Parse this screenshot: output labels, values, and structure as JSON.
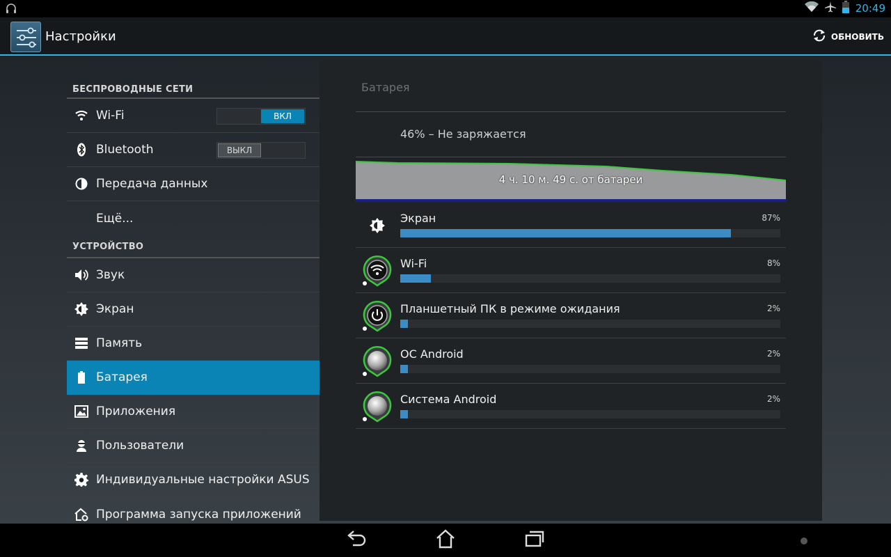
{
  "status_bar": {
    "time": "20:49",
    "icons": [
      "headset-icon",
      "wifi-icon",
      "airplane-icon",
      "battery-icon"
    ]
  },
  "action_bar": {
    "title": "Настройки",
    "refresh_label": "ОБНОВИТЬ",
    "app_icon": "settings-sliders-icon",
    "refresh_icon": "refresh-icon"
  },
  "sidebar": {
    "sections": [
      {
        "header": "БЕСПРОВОДНЫЕ СЕТИ",
        "items": [
          {
            "label": "Wi-Fi",
            "icon": "wifi-icon",
            "toggle": "ВКЛ",
            "toggle_on": true
          },
          {
            "label": "Bluetooth",
            "icon": "bluetooth-icon",
            "toggle": "ВЫКЛ",
            "toggle_on": false
          },
          {
            "label": "Передача данных",
            "icon": "data-usage-icon"
          },
          {
            "label": "Ещё..."
          }
        ]
      },
      {
        "header": "УСТРОЙСТВО",
        "items": [
          {
            "label": "Звук",
            "icon": "sound-icon"
          },
          {
            "label": "Экран",
            "icon": "display-icon"
          },
          {
            "label": "Память",
            "icon": "storage-icon"
          },
          {
            "label": "Батарея",
            "icon": "battery-icon",
            "selected": true
          },
          {
            "label": "Приложения",
            "icon": "apps-icon"
          },
          {
            "label": "Пользователи",
            "icon": "users-icon"
          },
          {
            "label": "Индивидуальные настройки ASUS",
            "icon": "gear-icon"
          },
          {
            "label": "Программа запуска приложений",
            "icon": "launcher-icon"
          }
        ]
      }
    ]
  },
  "battery": {
    "title": "Батарея",
    "status": "46% – Не заряжается",
    "graph_label": "4 ч. 10 м. 49 с. от батареи",
    "usage": [
      {
        "name": "Экран",
        "percent_label": "87%",
        "percent": 87,
        "icon": "brightness-icon"
      },
      {
        "name": "Wi-Fi",
        "percent_label": "8%",
        "percent": 8,
        "icon": "wifi-icon"
      },
      {
        "name": "Планшетный ПК в режиме ожидания",
        "percent_label": "2%",
        "percent": 2,
        "icon": "power-icon"
      },
      {
        "name": "ОС Android",
        "percent_label": "2%",
        "percent": 2,
        "icon": "android-os-icon"
      },
      {
        "name": "Система Android",
        "percent_label": "2%",
        "percent": 2,
        "icon": "android-system-icon"
      }
    ]
  },
  "nav_bar": {
    "buttons": [
      "back-icon",
      "home-icon",
      "recent-apps-icon"
    ]
  },
  "colors": {
    "accent": "#33b5e5",
    "selected": "#0a84b5",
    "bar_fill": "#3b8cc4",
    "graph_line": "#3cc83c"
  }
}
